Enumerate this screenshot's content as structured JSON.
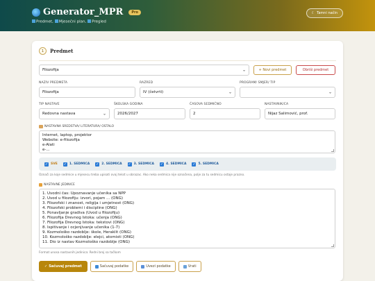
{
  "header": {
    "title": "Generator_MPR",
    "badge": "Pro",
    "nav": [
      "Predmet",
      "Mjesečni plan",
      "Pregled"
    ],
    "dark_mode_label": "Tamni način"
  },
  "section": {
    "step": "1",
    "title": "Predmet"
  },
  "subject_select": {
    "value": "Filozofija",
    "new_button": "+ Novi predmet",
    "delete_button": "Obriši predmet"
  },
  "labels": {
    "subject_name": "NAZIV PREDMETA",
    "grade": "RAZRED",
    "program": "PROGRAM/ SMJER/ TIP",
    "teaching_type": "TIP NASTAVE",
    "school_year": "ŠKOLSKA GODINA",
    "weekly_hours": "ČASOVA SEDMIČNO",
    "teacher": "NASTAVNIK/CA",
    "resources": "NASTAVNA SREDSTVA/ LITERATURA/ OSTALO",
    "units": "NASTAVNE JEDINICE"
  },
  "values": {
    "subject_name": "Filozofija",
    "grade": "IV (četvrti)",
    "program": "",
    "teaching_type": "Redovna nastava",
    "school_year": "2026/2027",
    "weekly_hours": "2",
    "teacher": "Nijaz Salimović, prof."
  },
  "resources_lines": [
    "Internet, laptop, projektor",
    "Website: e-filozofija",
    "e-Alati",
    "e-..."
  ],
  "weeks": [
    "SVE",
    "1. SEDMICA",
    "2. SEDMICA",
    "3. SEDMICA",
    "4. SEDMICA",
    "5. SEDMICA"
  ],
  "weeks_hint": "Označi za koje sedmice u mjesecu treba upisati ovaj tekst u obrazac. Ako neka sedmica nije označena, polje za tu sedmicu ostaje prazno.",
  "units_lines": [
    "1. Uvodni čas: Upoznavanje učenika sa NPP",
    "2. Uvod u filozofiju: izvori, pojam ... (ONG)",
    "3. Filozofski i znanost, religija i umjetnost (ONG)",
    "4. Filozofski problemi i discipline (ONG)",
    "5. Ponavljanje gradiva (Uvod u filozofiju)",
    "6. Filozofija Drevnog Istoka: učenja (ONG)",
    "7. Filozofija Drevnog Istoka: tekstovi (ONG)",
    "8. Ispitivanje i ocjenjivanje učenika (1-7)",
    "9. Kozmološko razdoblje: škole, Heraklit (ONG)",
    "10. Kozmološko razdoblje: elejci, atomisti (ONG)",
    "11. Dio iz nastav Kozmološko razdoblje (ONG)"
  ],
  "units_hint": "Format unosa nastavnih jedinica: Redni broj sa tačkom",
  "actions": {
    "save_subject": "Sačuvaj predmet",
    "save_data": "Sačuvaj podatke",
    "import_data": "Uvezi podatke",
    "back": "Vrati"
  }
}
